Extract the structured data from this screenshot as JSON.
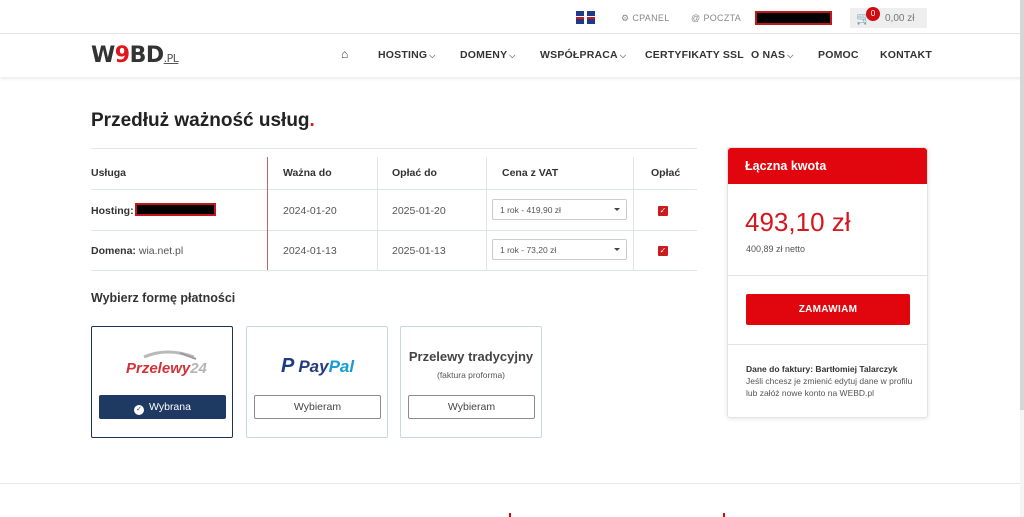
{
  "topbar": {
    "cpanel": "CPANEL",
    "poczta": "POCZTA",
    "cart_count": "0",
    "cart_amount": "0,00 zł"
  },
  "brand": {
    "w": "W",
    "nine": "9",
    "bd": "BD",
    "pl": ".PL"
  },
  "nav": {
    "items": [
      "HOSTING",
      "DOMENY",
      "WSPÓŁPRACA",
      "CERTYFIKATY SSL",
      "O NAS",
      "POMOC",
      "KONTAKT"
    ]
  },
  "page": {
    "title": "Przedłuż ważność usług",
    "title_dot": "."
  },
  "table": {
    "headers": [
      "Usługa",
      "Ważna do",
      "Opłać do",
      "Cena z VAT",
      "Opłać"
    ],
    "rows": [
      {
        "label": "Hosting:",
        "name": "",
        "valid_to": "2024-01-20",
        "pay_to": "2025-01-20",
        "price": "1 rok - 419,90 zł",
        "checked": "✓"
      },
      {
        "label": "Domena:",
        "name": "wia.net.pl",
        "valid_to": "2024-01-13",
        "pay_to": "2025-01-13",
        "price": "1 rok - 73,20 zł",
        "checked": "✓"
      }
    ]
  },
  "payment": {
    "heading": "Wybierz formę płatności",
    "options": [
      {
        "logo": "Przelewy",
        "logo_num": "24",
        "button": "Wybrana",
        "selected": true
      },
      {
        "logo_p": "Pay",
        "logo_pal": "Pal",
        "button": "Wybieram",
        "selected": false
      },
      {
        "title": "Przelewy tradycyjny",
        "subtitle": "(faktura proforma)",
        "button": "Wybieram",
        "selected": false
      }
    ]
  },
  "summary": {
    "heading": "Łączna kwota",
    "total": "493,10 zł",
    "netto": "400,89 zł netto",
    "order_button": "ZAMAWIAM",
    "invoice_label": "Dane do faktury: Bartłomiej Talarczyk",
    "invoice_note": "Jeśli chcesz je zmienić edytuj dane w profilu lub załóż nowe konto na WEBD.pl"
  },
  "colors": {
    "accent": "#e1060d",
    "selected_btn": "#1e3a62"
  }
}
